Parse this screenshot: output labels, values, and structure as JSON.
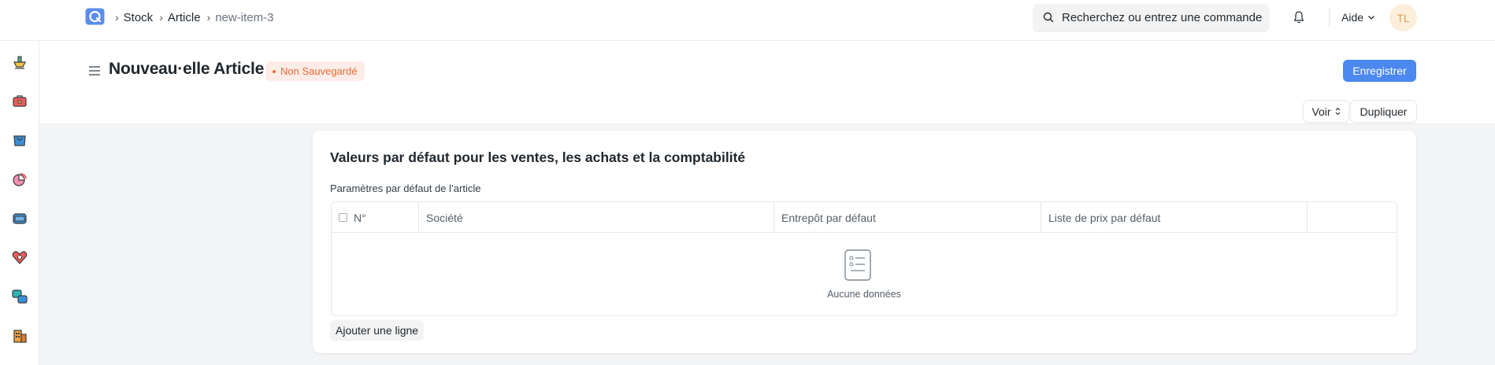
{
  "navbar": {
    "breadcrumbs": [
      "Stock",
      "Article",
      "new-item-3"
    ],
    "search_placeholder": "Recherchez ou entrez une commande",
    "help_label": "Aide",
    "avatar_initials": "TL"
  },
  "sidebar": {
    "icons": [
      "stock-icon",
      "tools-icon",
      "selling-icon",
      "chart-icon",
      "wallet-icon",
      "support-icon",
      "integrations-icon",
      "building-icon"
    ]
  },
  "page": {
    "title": "Nouveau·elle Article",
    "status": "Non Sauvegardé",
    "save_label": "Enregistrer",
    "view_label": "Voir",
    "duplicate_label": "Dupliquer"
  },
  "section": {
    "title": "Valeurs par défaut pour les ventes, les achats et la comptabilité",
    "field_label": "Paramètres par défaut de l’article",
    "table": {
      "columns": [
        "N°",
        "Société",
        "Entrepôt par défaut",
        "Liste de prix par défaut"
      ],
      "empty_text": "Aucune données"
    },
    "add_row_label": "Ajouter une ligne"
  },
  "colors": {
    "primary": "#4b88f0",
    "status": "#e86c3a",
    "avatar_bg": "#fdeedb"
  }
}
